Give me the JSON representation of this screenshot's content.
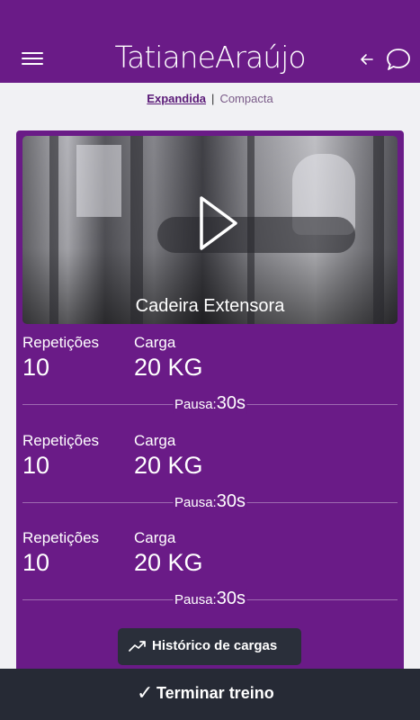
{
  "header": {
    "logo": "TatianeAraújo",
    "menu_icon": "hamburger-icon",
    "back_icon": "arrow-left-icon",
    "chat_icon": "chat-bubble-icon",
    "background": "#6a1b87"
  },
  "view_toggle": {
    "expanded": "Expandida",
    "separator": "|",
    "compact": "Compacta"
  },
  "exercise": {
    "title": "Cadeira Extensora",
    "play_icon": "play-icon",
    "sets": [
      {
        "reps_label": "Repetições",
        "reps": "10",
        "load_label": "Carga",
        "load": "20 KG",
        "pause_label": "Pausa:",
        "pause": "30s"
      },
      {
        "reps_label": "Repetições",
        "reps": "10",
        "load_label": "Carga",
        "load": "20 KG",
        "pause_label": "Pausa:",
        "pause": "30s"
      },
      {
        "reps_label": "Repetições",
        "reps": "10",
        "load_label": "Carga",
        "load": "20 KG",
        "pause_label": "Pausa:",
        "pause": "30s"
      }
    ]
  },
  "history_button": {
    "icon": "trending-up-icon",
    "label": "Histórico de cargas"
  },
  "footer": {
    "check": "✓",
    "label": "Terminar treino",
    "background": "#262a35"
  }
}
